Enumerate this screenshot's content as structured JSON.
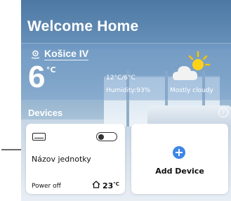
{
  "header": {
    "title": "Welcome Home"
  },
  "weather": {
    "location": "Košice IV",
    "temperature": "6",
    "unit": "°C",
    "range": "12°C/6°C",
    "humidity": "Humidity:93%",
    "condition": "Mostly cloudy",
    "icon": "partly-cloudy-icon"
  },
  "devices": {
    "label": "Devices",
    "help_symbol": "?",
    "items": [
      {
        "name": "Názov jednotky",
        "status": "Power off",
        "temperature": "23",
        "temperature_unit": "℃",
        "icon": "air-conditioner-icon",
        "toggle_on": false
      }
    ],
    "add_label": "Add Device",
    "add_symbol": "+"
  },
  "colors": {
    "accent": "#3e86e6",
    "panel": "#7aa0cd"
  }
}
